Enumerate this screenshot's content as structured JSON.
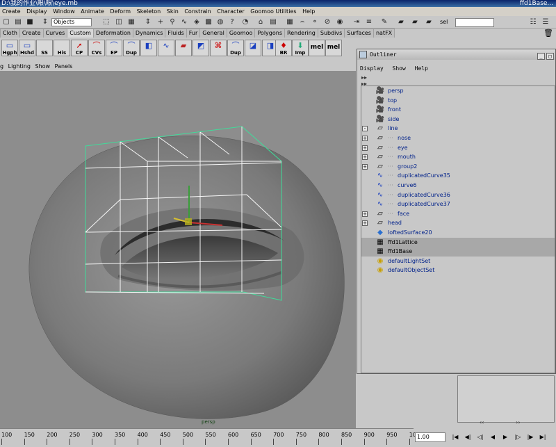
{
  "window": {
    "title": "D:\\我的作业\\眼\\眼\\eye.mb",
    "title_suffix": "ffd1Base..."
  },
  "menus": [
    "Create",
    "Display",
    "Window",
    "Animate",
    "Deform",
    "Skeleton",
    "Skin",
    "Constrain",
    "Character",
    "Goomoo Utilities",
    "Help"
  ],
  "statusline": {
    "mode": "Objects",
    "sel_label": "sel"
  },
  "shelf_tabs": [
    "Cloth",
    "Create",
    "Curves",
    "Custom",
    "Deformation",
    "Dynamics",
    "Fluids",
    "Fur",
    "General",
    "Goomoo",
    "Polygons",
    "Rendering",
    "Subdivs",
    "Surfaces",
    "natFX"
  ],
  "active_shelf_tab": "Custom",
  "shelf_buttons": [
    "Hgph",
    "Hshd",
    "SS",
    "His",
    "CP",
    "CVs",
    "EP",
    "Dup",
    "",
    "",
    "",
    "",
    "",
    "Dup",
    "",
    "",
    "BR",
    "Imp",
    "mel",
    "mel"
  ],
  "panel_menu": [
    "Lighting",
    "Show",
    "Panels"
  ],
  "panel_menu_cut": "g",
  "camera_label": "persp",
  "outliner": {
    "title": "Outliner",
    "menu": [
      "Display",
      "Show",
      "Help"
    ],
    "items": [
      {
        "name": "persp",
        "icon": "camera-icon",
        "indent": 0,
        "expand": "",
        "selected": false
      },
      {
        "name": "top",
        "icon": "camera-icon",
        "indent": 0,
        "expand": "",
        "selected": false
      },
      {
        "name": "front",
        "icon": "camera-icon",
        "indent": 0,
        "expand": "",
        "selected": false
      },
      {
        "name": "side",
        "icon": "camera-icon",
        "indent": 0,
        "expand": "",
        "selected": false
      },
      {
        "name": "line",
        "icon": "transform-icon",
        "indent": 0,
        "expand": "-",
        "selected": false
      },
      {
        "name": "nose",
        "icon": "transform-icon",
        "indent": 1,
        "expand": "+",
        "selected": false
      },
      {
        "name": "eye",
        "icon": "transform-icon",
        "indent": 1,
        "expand": "+",
        "selected": false
      },
      {
        "name": "mouth",
        "icon": "transform-icon",
        "indent": 1,
        "expand": "+",
        "selected": false
      },
      {
        "name": "group2",
        "icon": "transform-icon",
        "indent": 1,
        "expand": "+",
        "selected": false
      },
      {
        "name": "duplicatedCurve35",
        "icon": "curve-icon",
        "indent": 1,
        "expand": "",
        "selected": false
      },
      {
        "name": "curve6",
        "icon": "curve-icon",
        "indent": 1,
        "expand": "",
        "selected": false
      },
      {
        "name": "duplicatedCurve36",
        "icon": "curve-icon",
        "indent": 1,
        "expand": "",
        "selected": false
      },
      {
        "name": "duplicatedCurve37",
        "icon": "curve-icon",
        "indent": 1,
        "expand": "",
        "selected": false
      },
      {
        "name": "face",
        "icon": "transform-icon",
        "indent": 1,
        "expand": "+",
        "selected": false
      },
      {
        "name": "head",
        "icon": "transform-icon",
        "indent": 0,
        "expand": "+",
        "selected": false
      },
      {
        "name": "loftedSurface20",
        "icon": "surface-icon",
        "indent": 0,
        "expand": "",
        "selected": false
      },
      {
        "name": "ffd1Lattice",
        "icon": "lattice-icon",
        "indent": 0,
        "expand": "",
        "selected": true
      },
      {
        "name": "ffd1Base",
        "icon": "lattice-icon",
        "indent": 0,
        "expand": "",
        "selected": true
      },
      {
        "name": "defaultLightSet",
        "icon": "set-icon",
        "indent": 0,
        "expand": "",
        "selected": false
      },
      {
        "name": "defaultObjectSet",
        "icon": "set-icon",
        "indent": 0,
        "expand": "",
        "selected": false
      }
    ]
  },
  "timeline": {
    "ticks": [
      "100",
      "150",
      "200",
      "250",
      "300",
      "350",
      "400",
      "450",
      "500",
      "550",
      "600",
      "650",
      "700",
      "750",
      "800",
      "850",
      "900",
      "950",
      "1000"
    ],
    "current_time": "1.00"
  },
  "colors": {
    "viewport_bg": "#8d8d8d",
    "lattice": "#ffffff",
    "lattice_outline": "#3fdc9a",
    "selected_row": "#a8a8a8",
    "item_text": "#00218a"
  }
}
